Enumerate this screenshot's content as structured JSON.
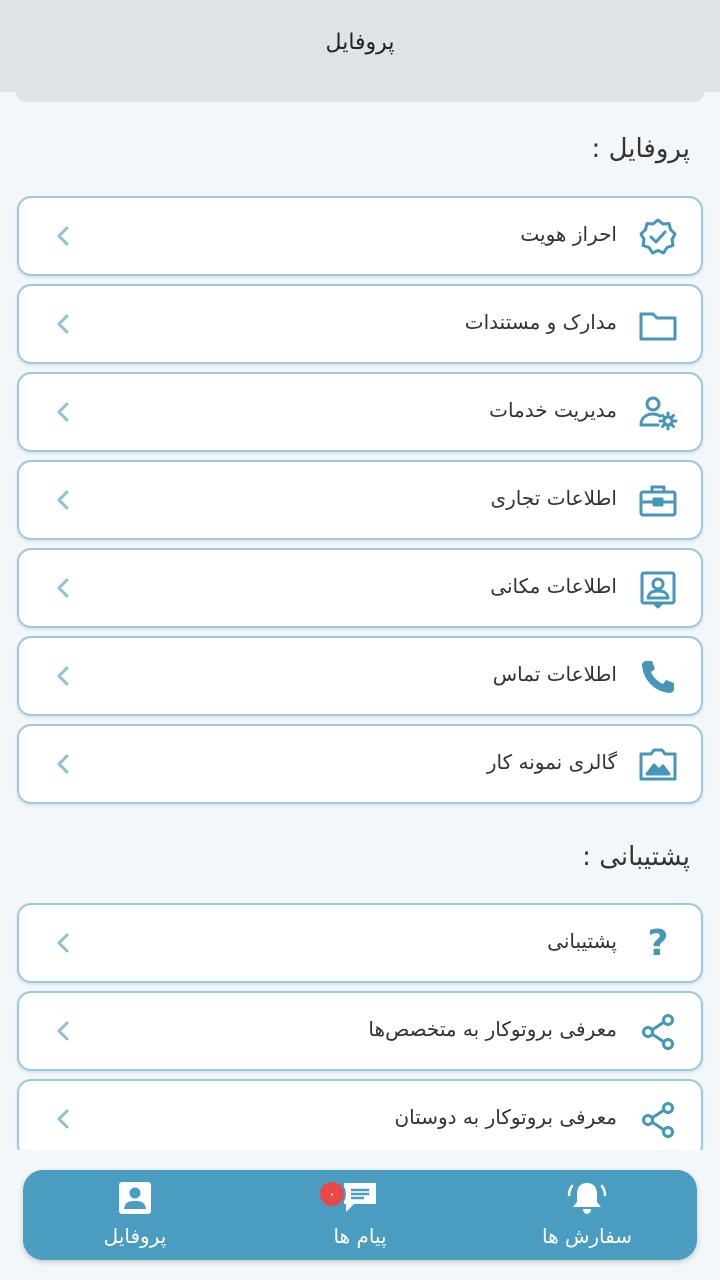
{
  "header": {
    "title": "پروفایل"
  },
  "sections": {
    "profile": {
      "title": "پروفایل :"
    },
    "support": {
      "title": "پشتیبانی :"
    }
  },
  "profile_items": [
    {
      "label": "احراز هویت",
      "icon": "verified-badge-icon"
    },
    {
      "label": "مدارک و مستندات",
      "icon": "folder-icon"
    },
    {
      "label": "مدیریت خدمات",
      "icon": "user-settings-icon"
    },
    {
      "label": "اطلاعات تجاری",
      "icon": "briefcase-icon"
    },
    {
      "label": "اطلاعات مکانی",
      "icon": "location-card-icon"
    },
    {
      "label": "اطلاعات تماس",
      "icon": "phone-icon"
    },
    {
      "label": "گالری نمونه کار",
      "icon": "gallery-icon"
    }
  ],
  "support_items": [
    {
      "label": "پشتیبانی",
      "icon": "question-icon"
    },
    {
      "label": "معرفی بروتوکار به متخصص‌ها",
      "icon": "share-icon"
    },
    {
      "label": "معرفی بروتوکار به دوستان",
      "icon": "share-icon"
    }
  ],
  "bottom_nav": {
    "orders": {
      "label": "سفارش ها",
      "icon": "bell-icon"
    },
    "messages": {
      "label": "پیام ها",
      "icon": "chat-icon",
      "badge": "۰"
    },
    "profile": {
      "label": "پروفایل",
      "icon": "profile-card-icon"
    }
  },
  "colors": {
    "accent": "#4a9dc0",
    "icon": "#4596b8",
    "card_border": "#9ec8dc",
    "badge": "#e84848",
    "header_bg": "#dde3e7"
  }
}
